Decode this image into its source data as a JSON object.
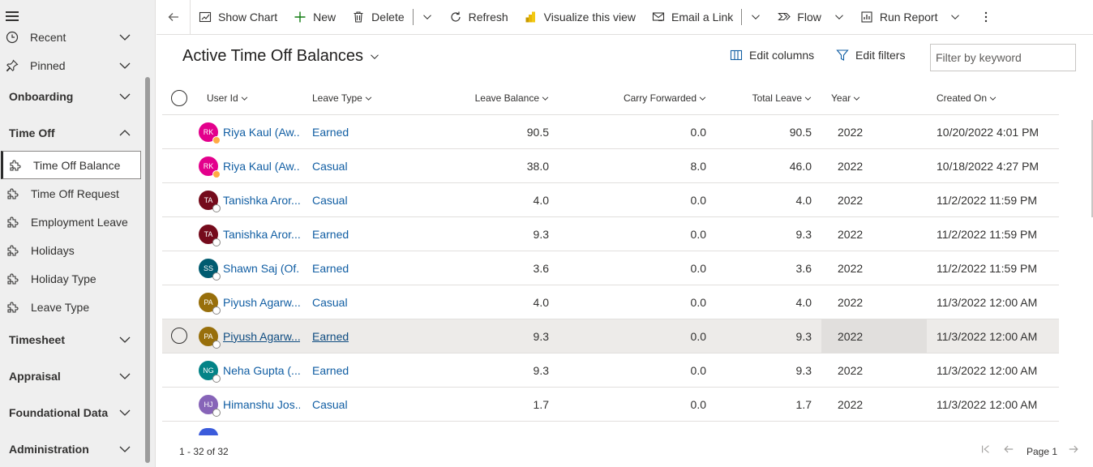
{
  "sidebar": {
    "recent_label": "Recent",
    "pinned_label": "Pinned",
    "groups": {
      "onboarding": "Onboarding",
      "time_off": "Time Off",
      "timesheet": "Timesheet",
      "appraisal": "Appraisal",
      "foundational_data": "Foundational Data",
      "administration": "Administration"
    },
    "time_off_items": [
      {
        "label": "Time Off Balance",
        "selected": true
      },
      {
        "label": "Time Off Request"
      },
      {
        "label": "Employment Leave"
      },
      {
        "label": "Holidays"
      },
      {
        "label": "Holiday Type"
      },
      {
        "label": "Leave Type"
      }
    ]
  },
  "toolbar": {
    "show_chart": "Show Chart",
    "new": "New",
    "delete": "Delete",
    "refresh": "Refresh",
    "visualize": "Visualize this view",
    "email_link": "Email a Link",
    "flow": "Flow",
    "run_report": "Run Report"
  },
  "view": {
    "title": "Active Time Off Balances",
    "edit_columns": "Edit columns",
    "edit_filters": "Edit filters",
    "filter_placeholder": "Filter by keyword"
  },
  "grid": {
    "columns": {
      "user_id": "User Id",
      "leave_type": "Leave Type",
      "leave_balance": "Leave Balance",
      "carry_forwarded": "Carry Forwarded",
      "total_leave": "Total Leave",
      "year": "Year",
      "created_on": "Created On"
    },
    "rows": [
      {
        "initials": "RK",
        "avatar_color": "#e3008c",
        "presence": "away",
        "user": "Riya Kaul (Aw...",
        "leave_type": "Earned",
        "leave_balance": "90.5",
        "carry_forwarded": "0.0",
        "total_leave": "90.5",
        "year": "2022",
        "created_on": "10/20/2022 4:01 PM"
      },
      {
        "initials": "RK",
        "avatar_color": "#e3008c",
        "presence": "away",
        "user": "Riya Kaul (Aw...",
        "leave_type": "Casual",
        "leave_balance": "38.0",
        "carry_forwarded": "8.0",
        "total_leave": "46.0",
        "year": "2022",
        "created_on": "10/18/2022 4:27 PM"
      },
      {
        "initials": "TA",
        "avatar_color": "#750b1c",
        "presence": "offline",
        "user": "Tanishka Aror...",
        "leave_type": "Casual",
        "leave_balance": "4.0",
        "carry_forwarded": "0.0",
        "total_leave": "4.0",
        "year": "2022",
        "created_on": "11/2/2022 11:59 PM"
      },
      {
        "initials": "TA",
        "avatar_color": "#750b1c",
        "presence": "offline",
        "user": "Tanishka Aror...",
        "leave_type": "Earned",
        "leave_balance": "9.3",
        "carry_forwarded": "0.0",
        "total_leave": "9.3",
        "year": "2022",
        "created_on": "11/2/2022 11:59 PM"
      },
      {
        "initials": "SS",
        "avatar_color": "#005b70",
        "presence": "offline",
        "user": "Shawn Saj (Of...",
        "leave_type": "Earned",
        "leave_balance": "3.6",
        "carry_forwarded": "0.0",
        "total_leave": "3.6",
        "year": "2022",
        "created_on": "11/2/2022 11:59 PM"
      },
      {
        "initials": "PA",
        "avatar_color": "#986f0b",
        "presence": "offline",
        "user": "Piyush Agarw...",
        "leave_type": "Casual",
        "leave_balance": "4.0",
        "carry_forwarded": "0.0",
        "total_leave": "4.0",
        "year": "2022",
        "created_on": "11/3/2022 12:00 AM"
      },
      {
        "initials": "PA",
        "avatar_color": "#986f0b",
        "presence": "offline",
        "user": "Piyush Agarw...",
        "leave_type": "Earned",
        "leave_balance": "9.3",
        "carry_forwarded": "0.0",
        "total_leave": "9.3",
        "year": "2022",
        "created_on": "11/3/2022 12:00 AM",
        "hover": true
      },
      {
        "initials": "NG",
        "avatar_color": "#038387",
        "presence": "offline",
        "user": "Neha Gupta (...",
        "leave_type": "Earned",
        "leave_balance": "9.3",
        "carry_forwarded": "0.0",
        "total_leave": "9.3",
        "year": "2022",
        "created_on": "11/3/2022 12:00 AM"
      },
      {
        "initials": "HJ",
        "avatar_color": "#8764b8",
        "presence": "offline",
        "user": "Himanshu Jos...",
        "leave_type": "Casual",
        "leave_balance": "1.7",
        "carry_forwarded": "0.0",
        "total_leave": "1.7",
        "year": "2022",
        "created_on": "11/3/2022 12:00 AM"
      }
    ]
  },
  "footer": {
    "record_count": "1 - 32 of 32",
    "page_label": "Page 1"
  },
  "colors": {
    "link": "#115ea3",
    "selected_border": "#2c2c2c",
    "sidebar_bg": "#efefef"
  }
}
